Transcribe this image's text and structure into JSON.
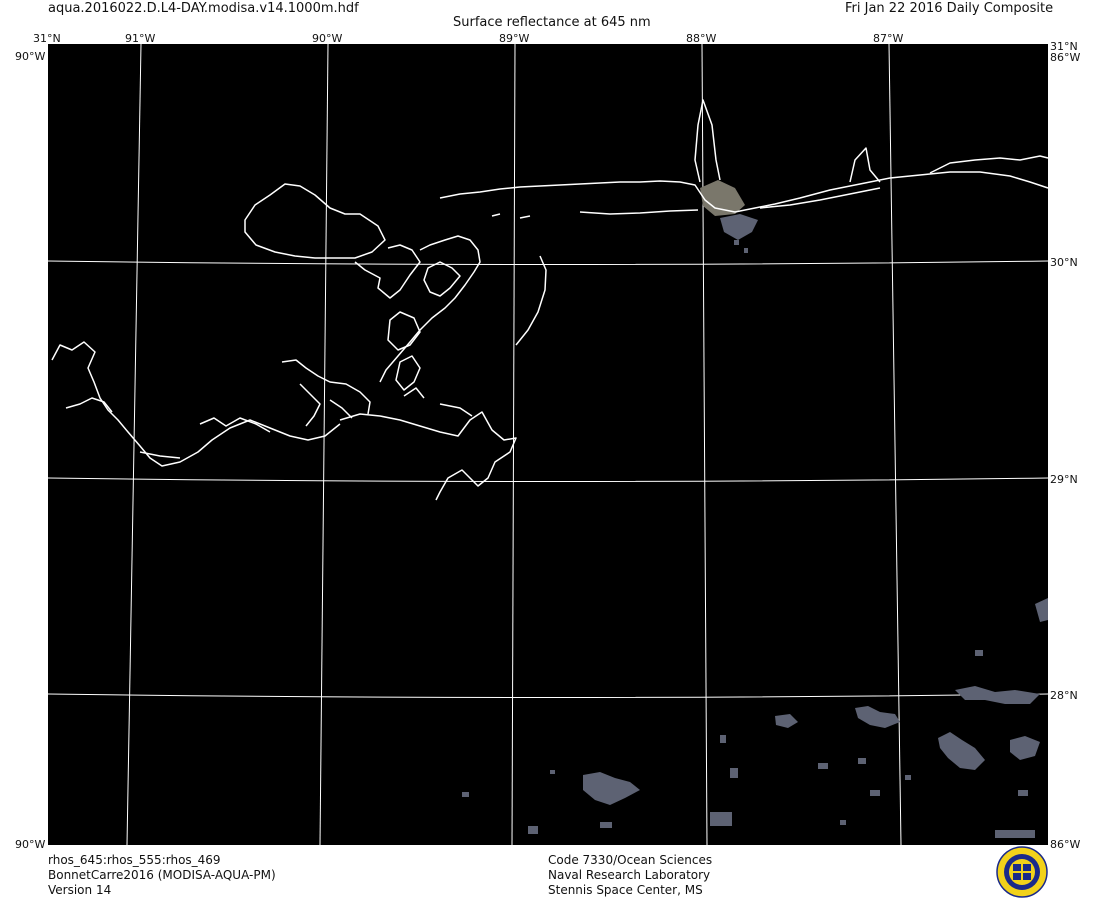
{
  "header": {
    "filename": "aqua.2016022.D.L4-DAY.modisa.v14.1000m.hdf",
    "title": "Surface reflectance at 645 nm",
    "date": "Fri Jan 22 2016 Daily Composite"
  },
  "footer": {
    "left": [
      "rhos_645:rhos_555:rhos_469",
      "BonnetCarre2016 (MODISA-AQUA-PM)",
      "Version 14"
    ],
    "center": [
      "Code 7330/Ocean Sciences",
      "Naval Research Laboratory",
      "Stennis Space Center, MS"
    ]
  },
  "axes": {
    "top_lon": [
      "91°W",
      "90°W",
      "89°W",
      "88°W",
      "87°W"
    ],
    "corner_lat": "31°N",
    "lat_labels": [
      "30°N",
      "29°N",
      "28°N"
    ],
    "corner_lon_left": "90°W",
    "corner_lon_right": "86°W"
  },
  "colors": {
    "map_background": "#000000",
    "coastline": "#ffffff",
    "gridline": "#ffffff",
    "sediment": "#7a776b",
    "cloud_pixels": "#5d6273"
  },
  "icons": {
    "seal": "nrl-seal-icon"
  }
}
